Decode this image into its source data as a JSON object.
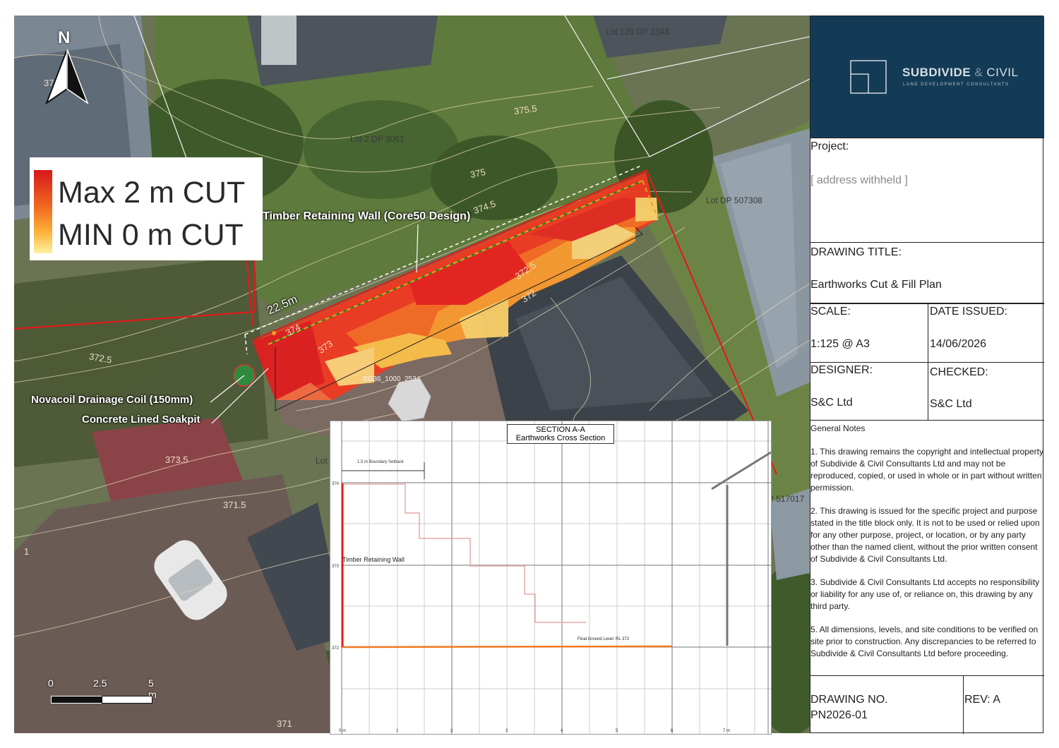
{
  "legend": {
    "max_label": "Max 2 m  CUT",
    "min_label": "MIN 0 m  CUT",
    "max_color": "#d6191c",
    "min_color": "#fff1a0"
  },
  "north_label": "N",
  "scale_bar": {
    "labels": [
      "0",
      "2.5",
      "5 m"
    ]
  },
  "map_labels": {
    "retaining_wall": "Timber Retaining Wall (Core50 Design)",
    "drainage_coil": "Novacoil Drainage Coil (150mm)",
    "soakpit": "Concrete Lined Soakpit",
    "dimension": "22.5m",
    "benchmark": "BG36_1000_2534"
  },
  "lot_labels": [
    "Lot 120 DP 2343",
    "Lot 2 DP 3061",
    "Lot  DP 507308",
    "P 517017",
    "Lot"
  ],
  "contour_labels": [
    "375.5",
    "375",
    "374.5",
    "374",
    "373",
    "372.5",
    "372",
    "373.5",
    "371.5",
    "371",
    "37",
    "372.5",
    "1"
  ],
  "section": {
    "title": "SECTION A-A",
    "subtitle": "Earthworks Cross Section",
    "setback_label": "1.5 m Boundary Setback",
    "wall_label": "Timber Retaining Wall",
    "fgl_label": "Final Ground Level: RL 372",
    "y_ticks": [
      "374",
      "373",
      "372"
    ],
    "x_ticks": [
      "0 m",
      "1",
      "2",
      "3",
      "4",
      "5",
      "6",
      "7 m"
    ]
  },
  "title_block": {
    "company": "SUBDIVIDE & CIVIL",
    "company_main": "SUBDIVIDE",
    "company_amp": "&",
    "company_end": "CIVIL",
    "tagline": "LAND DEVELOPMENT CONSULTANTS",
    "brand_color": "#133b55",
    "project_label": "Project:",
    "project_value": "[ address withheld ]",
    "drawing_title_label": "DRAWING TITLE:",
    "drawing_title_value": "Earthworks Cut & Fill Plan",
    "scale_label": "SCALE:",
    "scale_value": "1:125 @ A3",
    "date_label": "DATE ISSUED:",
    "date_value": "14/06/2026",
    "designer_label": "DESIGNER:",
    "designer_value": "S&C Ltd",
    "checked_label": "CHECKED:",
    "checked_value": "S&C Ltd",
    "notes_heading": "General Notes",
    "notes": [
      "1. This drawing remains the copyright and intellectual property of Subdivide & Civil Consultants Ltd and may not be reproduced, copied, or used in whole or in part without written permission.",
      "2. This drawing is issued for the specific project and purpose stated in the title block only. It is not to be used or relied upon for any other purpose, project, or location, or by any party other than the named client, without the prior written consent of Subdivide & Civil Consultants Ltd.",
      "3. Subdivide & Civil Consultants Ltd accepts no responsibility or liability for any use of, or reliance on, this drawing by any third party.",
      "5. All dimensions, levels, and site conditions to be verified on site prior to construction. Any discrepancies to be referred to Subdivide & Civil Consultants Ltd before proceeding."
    ],
    "drawing_no_label": "DRAWING NO.",
    "drawing_no_value": "PN2026-01",
    "rev_label": "REV: A"
  }
}
